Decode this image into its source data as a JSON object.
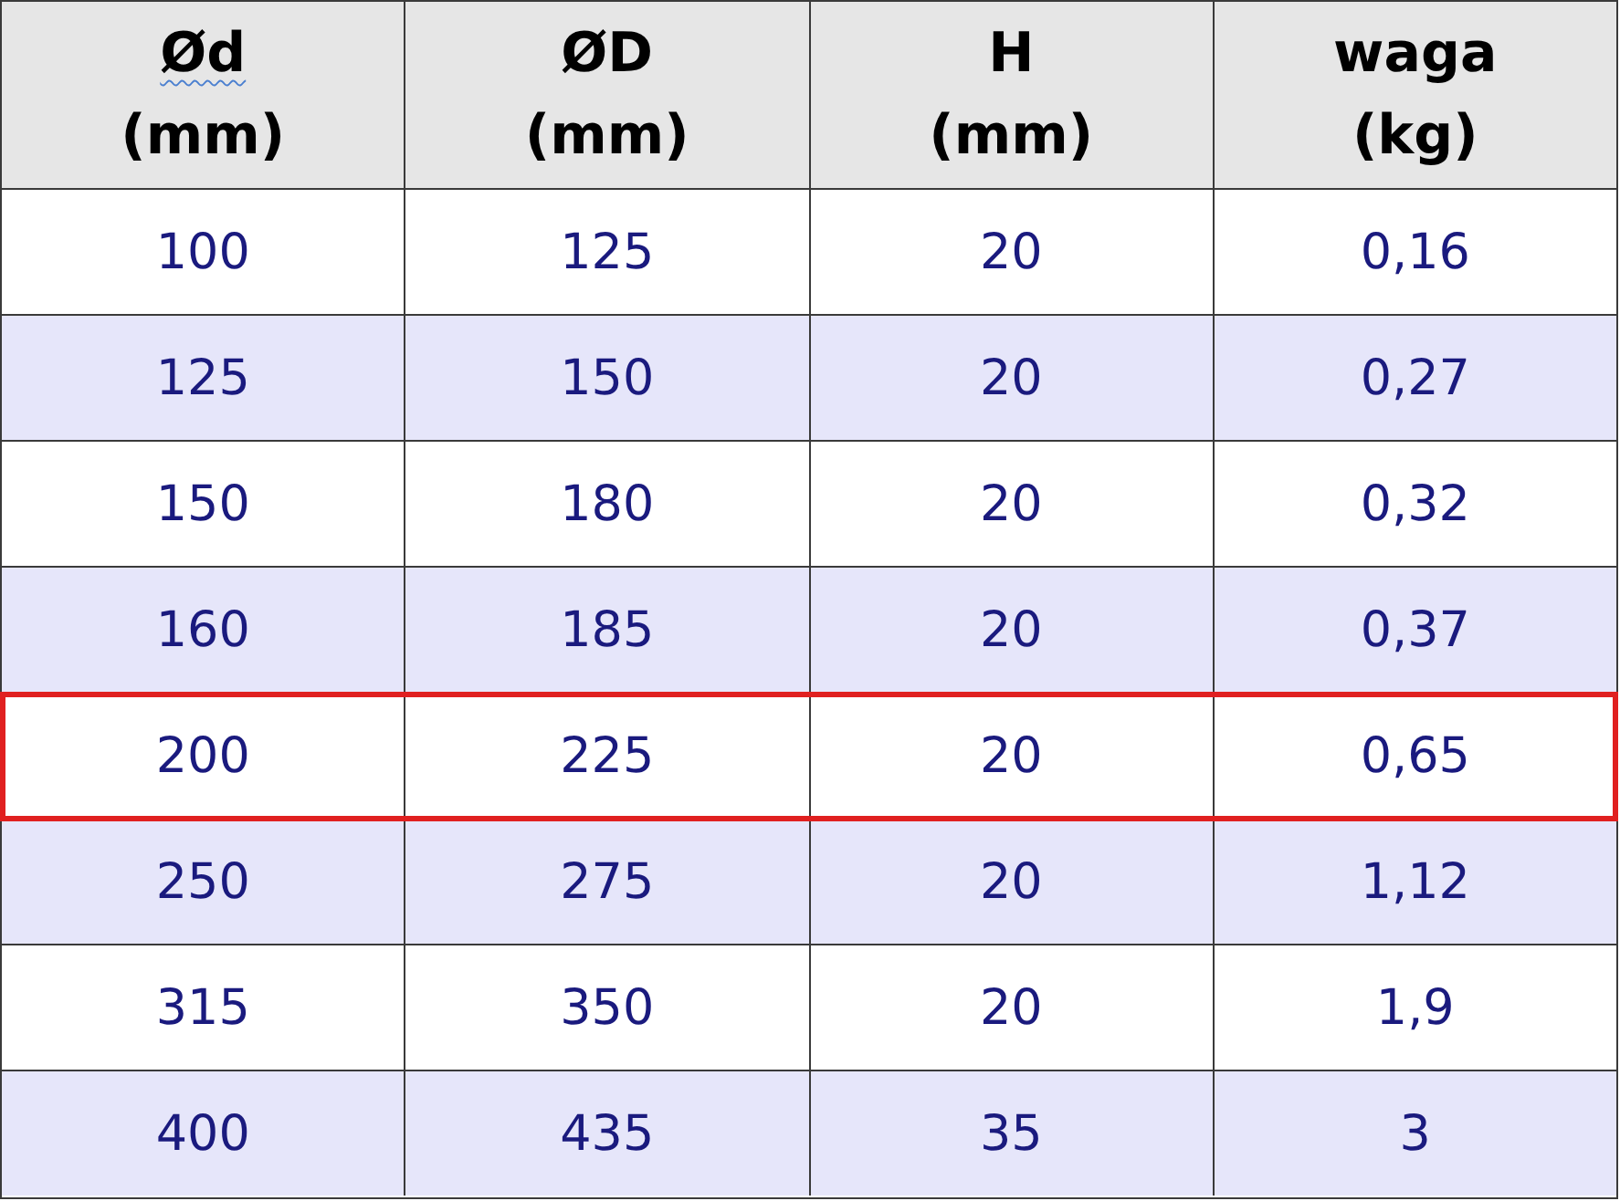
{
  "table": {
    "columns": [
      {
        "name": "Ød",
        "unit": "(mm)",
        "misspelled": true
      },
      {
        "name": "ØD",
        "unit": "(mm)",
        "misspelled": false
      },
      {
        "name": "H",
        "unit": "(mm)",
        "misspelled": false
      },
      {
        "name": "waga",
        "unit": "(kg)",
        "misspelled": false
      }
    ],
    "rows": [
      {
        "cells": [
          "100",
          "125",
          "20",
          "0,16"
        ],
        "selected": false
      },
      {
        "cells": [
          "125",
          "150",
          "20",
          "0,27"
        ],
        "selected": false
      },
      {
        "cells": [
          "150",
          "180",
          "20",
          "0,32"
        ],
        "selected": false
      },
      {
        "cells": [
          "160",
          "185",
          "20",
          "0,37"
        ],
        "selected": false
      },
      {
        "cells": [
          "200",
          "225",
          "20",
          "0,65"
        ],
        "selected": true
      },
      {
        "cells": [
          "250",
          "275",
          "20",
          "1,12"
        ],
        "selected": false
      },
      {
        "cells": [
          "315",
          "350",
          "20",
          "1,9"
        ],
        "selected": false
      },
      {
        "cells": [
          "400",
          "435",
          "35",
          "3"
        ],
        "selected": false
      }
    ]
  }
}
